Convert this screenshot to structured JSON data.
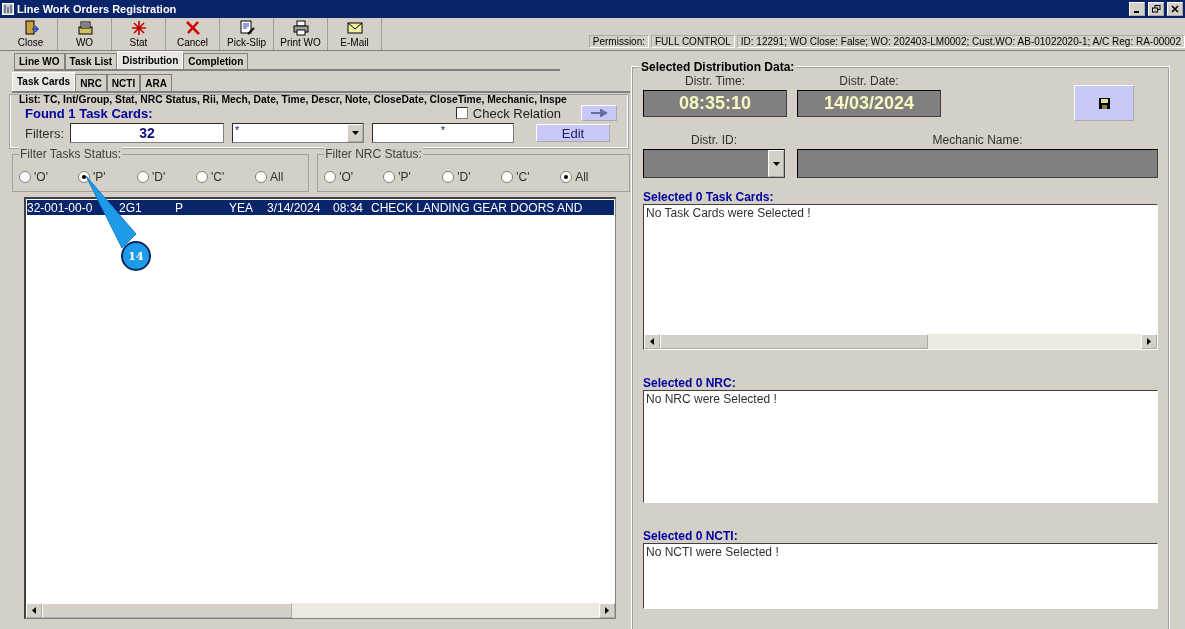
{
  "window": {
    "title": "Line Work Orders Registration"
  },
  "toolbar": [
    {
      "label": "Close",
      "kind": "door"
    },
    {
      "label": "WO",
      "kind": "tray"
    },
    {
      "label": "Stat",
      "kind": "star"
    },
    {
      "label": "Cancel",
      "kind": "cross"
    },
    {
      "label": "Pick-Slip",
      "kind": "note"
    },
    {
      "label": "Print WO",
      "kind": "printer"
    },
    {
      "label": "E-Mail",
      "kind": "envelope"
    }
  ],
  "permission": {
    "label": "Permission:",
    "value": "FULL CONTROL",
    "info": "ID: 12291; WO Close: False; WO: 202403-LM0002; Cust.WO: AB-01022020-1; A/C Reg: RA-00002"
  },
  "tabs": [
    {
      "label": "Line WO",
      "selected": false
    },
    {
      "label": "Task List",
      "selected": false
    },
    {
      "label": "Distribution",
      "selected": true
    },
    {
      "label": "Completion",
      "selected": false
    }
  ],
  "subtabs": [
    {
      "label": "Task Cards",
      "selected": true
    },
    {
      "label": "NRC",
      "selected": false
    },
    {
      "label": "NCTI",
      "selected": false
    },
    {
      "label": "ARA",
      "selected": false
    }
  ],
  "list": {
    "header": "List: TC, Int/Group, Stat, NRC Status, Rii, Mech, Date, Time, Descr, Note, CloseDate, CloseTime, Mechanic, Inspe",
    "found": "Found 1 Task Cards:",
    "check_relation": {
      "label": "Check Relation",
      "checked": false
    },
    "filters_label": "Filters:",
    "filters": [
      {
        "value": "32",
        "kind": "text"
      },
      {
        "value": "*",
        "kind": "combo"
      },
      {
        "value": "*",
        "kind": "text"
      }
    ],
    "edit_button": "Edit"
  },
  "task_status": {
    "title": "Filter Tasks Status:",
    "options": [
      {
        "label": "'O'",
        "selected": false
      },
      {
        "label": "'P'",
        "selected": true
      },
      {
        "label": "'D'",
        "selected": false
      },
      {
        "label": "'C'",
        "selected": false
      },
      {
        "label": "All",
        "selected": false
      }
    ]
  },
  "nrc_status": {
    "title": "Filter NRC Status:",
    "options": [
      {
        "label": "'O'",
        "selected": false
      },
      {
        "label": "'P'",
        "selected": false
      },
      {
        "label": "'D'",
        "selected": false
      },
      {
        "label": "'C'",
        "selected": false
      },
      {
        "label": "All",
        "selected": true
      }
    ]
  },
  "rows": [
    {
      "selected": true,
      "cells": [
        "32-001-00-0",
        "2G1",
        "P",
        "YEA",
        "3/14/2024",
        "08:34",
        "CHECK LANDING GEAR DOORS AND"
      ]
    }
  ],
  "callout": {
    "text": "14"
  },
  "distribution": {
    "title": "Selected Distribution Data:",
    "time_label": "Distr. Time:",
    "time": "08:35:10",
    "date_label": "Distr. Date:",
    "date": "14/03/2024",
    "id_label": "Distr. ID:",
    "mechanic_label": "Mechanic Name:"
  },
  "sections": [
    {
      "title": "Selected 0 Task Cards:",
      "text": "No Task Cards were Selected !",
      "has_scrollbar": true
    },
    {
      "title": "Selected 0 NRC:",
      "text": "No NRC were Selected !",
      "has_scrollbar": false
    },
    {
      "title": "Selected 0 NCTI:",
      "text": "No NCTI were Selected !",
      "has_scrollbar": false
    }
  ]
}
